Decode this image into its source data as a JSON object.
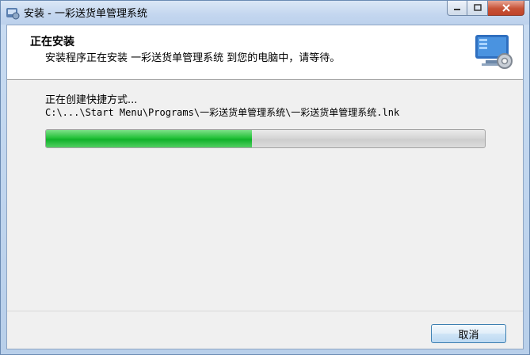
{
  "window": {
    "title": "安装 - 一彩送货单管理系统",
    "minimize_icon": "minimize-icon",
    "maximize_icon": "maximize-icon",
    "close_icon": "close-icon"
  },
  "header": {
    "title": "正在安装",
    "subtitle": "安装程序正在安装 一彩送货单管理系统 到您的电脑中，请等待。",
    "icon": "installer-computer-icon"
  },
  "status": {
    "label": "正在创建快捷方式...",
    "path": "C:\\...\\Start Menu\\Programs\\一彩送货单管理系统\\一彩送货单管理系统.lnk"
  },
  "progress": {
    "value": 0.47,
    "color": "#11b22a"
  },
  "buttons": {
    "cancel_label": "取消"
  }
}
